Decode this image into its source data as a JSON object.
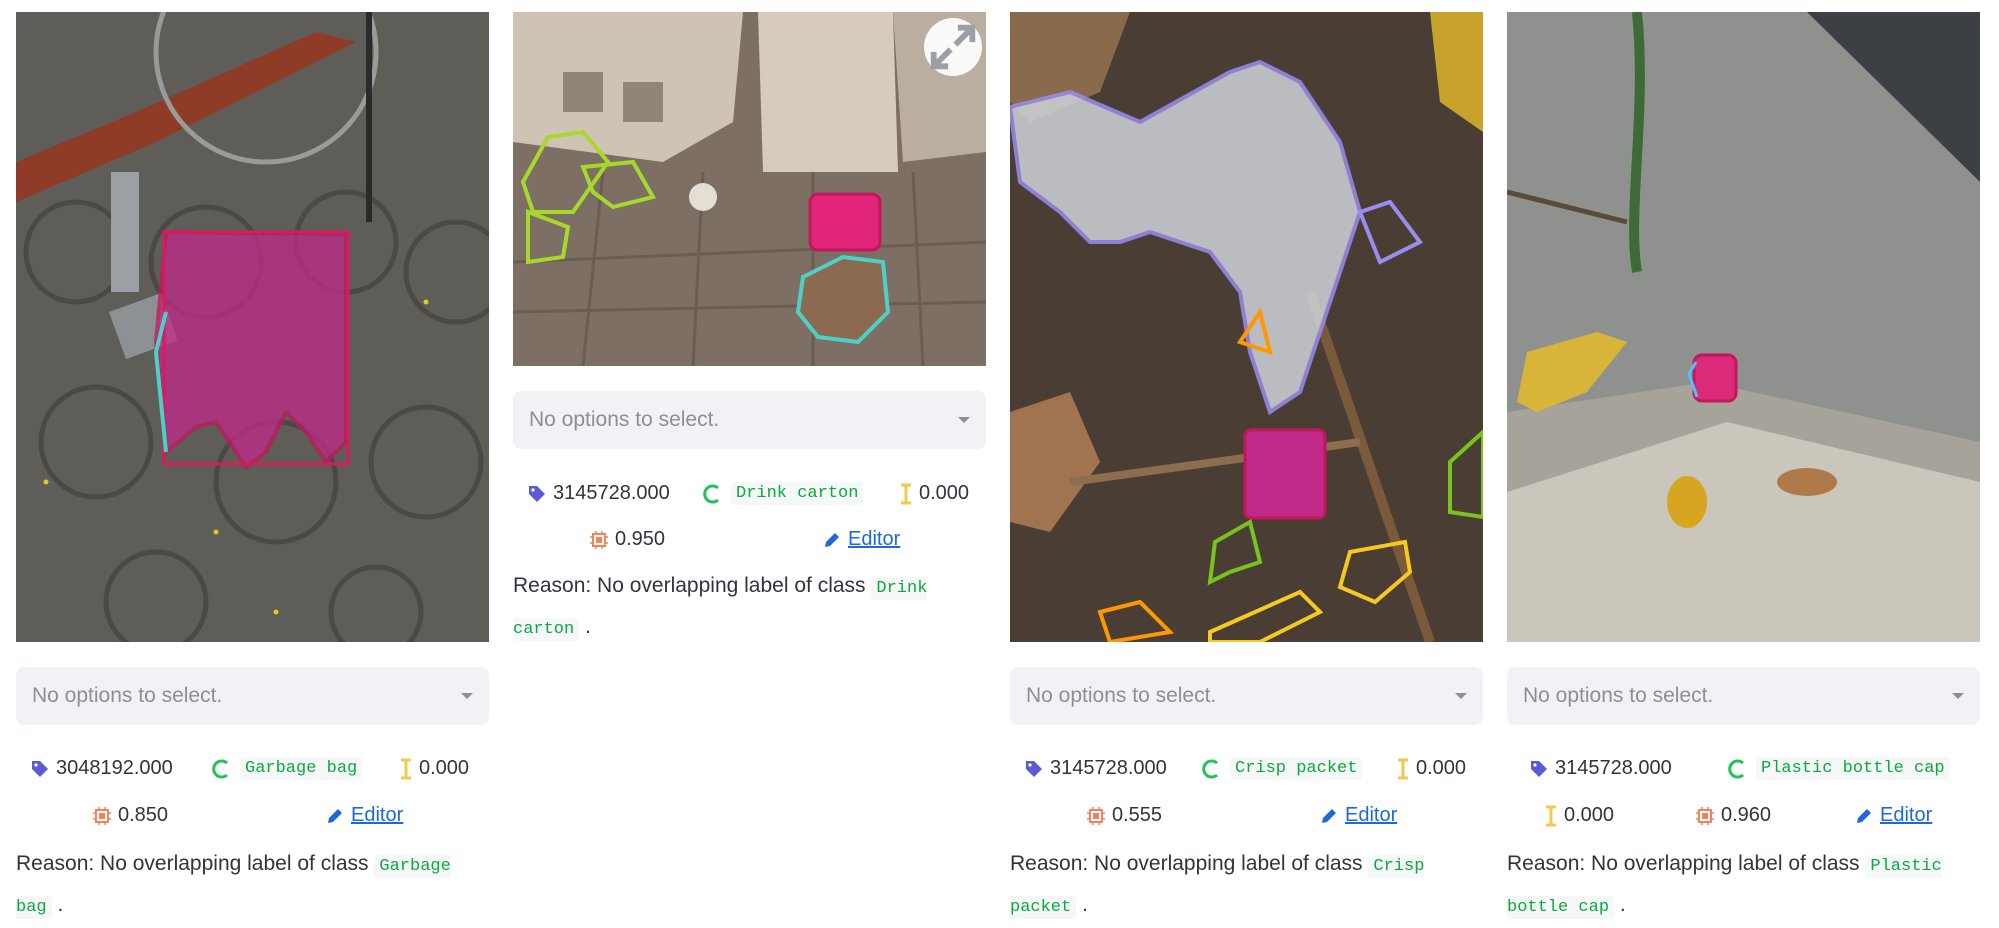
{
  "select_placeholder": "No options to select.",
  "cards": [
    {
      "area": "3048192.000",
      "cls": "Garbage bag",
      "iou": "0.000",
      "score": "0.850",
      "editor_label": "Editor",
      "reason_prefix": "Reason: No overlapping label of class",
      "reason_class": "Garbage bag",
      "reason_suffix": "."
    },
    {
      "area": "3145728.000",
      "cls": "Drink carton",
      "iou": "0.000",
      "score": "0.950",
      "editor_label": "Editor",
      "reason_prefix": "Reason: No overlapping label of class",
      "reason_class": "Drink carton",
      "reason_suffix": "."
    },
    {
      "area": "3145728.000",
      "cls": "Crisp packet",
      "iou": "0.000",
      "score": "0.555",
      "editor_label": "Editor",
      "reason_prefix": "Reason: No overlapping label of class",
      "reason_class": "Crisp packet",
      "reason_suffix": "."
    },
    {
      "area": "3145728.000",
      "cls": "Plastic bottle cap",
      "iou": "0.000",
      "score": "0.960",
      "editor_label": "Editor",
      "reason_prefix": "Reason: No overlapping label of class",
      "reason_class": "Plastic bottle cap",
      "reason_suffix": "."
    }
  ],
  "icons": {
    "area": "tag-icon",
    "class": "class-c-icon",
    "iou": "iou-i-icon",
    "score": "chip-icon",
    "editor": "pencil-icon",
    "expand": "expand-icon"
  },
  "colors": {
    "tag": "#5b5bd6",
    "class_icon": "#21c354",
    "iou_icon": "#f2c94c",
    "chip": "#f2845c",
    "editor": "#1c6ad8",
    "code_text": "#09ab3b"
  }
}
